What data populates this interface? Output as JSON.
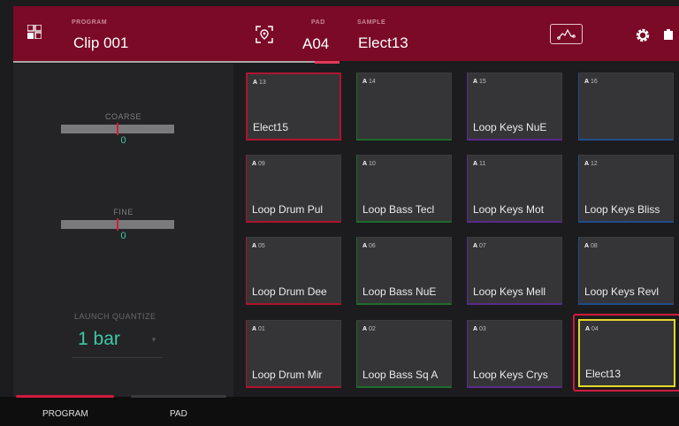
{
  "header": {
    "program_label": "PROGRAM",
    "program_value": "Clip 001",
    "pad_label": "PAD",
    "pad_value": "A04",
    "sample_label": "SAMPLE",
    "sample_value": "Elect13",
    "icons": [
      "grid-icon",
      "locate-icon",
      "envelope-icon",
      "gear-icon",
      "battery-icon"
    ]
  },
  "left_panel": {
    "coarse_label": "COARSE",
    "coarse_value": "0",
    "fine_label": "FINE",
    "fine_value": "0",
    "launch_quantize_label": "LAUNCH QUANTIZE",
    "launch_quantize_value": "1 bar"
  },
  "pads": [
    {
      "bank": "A",
      "num": "13",
      "name": "Elect15",
      "color": "red"
    },
    {
      "bank": "A",
      "num": "14",
      "name": "",
      "color": "green"
    },
    {
      "bank": "A",
      "num": "15",
      "name": "Loop Keys NuE",
      "color": "purple"
    },
    {
      "bank": "A",
      "num": "16",
      "name": "",
      "color": "blue"
    },
    {
      "bank": "A",
      "num": "09",
      "name": "Loop Drum Pul",
      "color": "red"
    },
    {
      "bank": "A",
      "num": "10",
      "name": "Loop Bass Tecl",
      "color": "green"
    },
    {
      "bank": "A",
      "num": "11",
      "name": "Loop Keys Mot",
      "color": "purple"
    },
    {
      "bank": "A",
      "num": "12",
      "name": "Loop Keys Bliss",
      "color": "blue"
    },
    {
      "bank": "A",
      "num": "05",
      "name": "Loop Drum Dee",
      "color": "red"
    },
    {
      "bank": "A",
      "num": "06",
      "name": "Loop Bass NuE",
      "color": "green"
    },
    {
      "bank": "A",
      "num": "07",
      "name": "Loop Keys Mell",
      "color": "purple"
    },
    {
      "bank": "A",
      "num": "08",
      "name": "Loop Keys Revl",
      "color": "blue"
    },
    {
      "bank": "A",
      "num": "01",
      "name": "Loop Drum Mir",
      "color": "red"
    },
    {
      "bank": "A",
      "num": "02",
      "name": "Loop Bass Sq A",
      "color": "green"
    },
    {
      "bank": "A",
      "num": "03",
      "name": "Loop Keys Crys",
      "color": "purple"
    },
    {
      "bank": "A",
      "num": "04",
      "name": "Elect13",
      "color": "selected"
    }
  ],
  "tabs": [
    {
      "label": "PROGRAM",
      "active": true
    },
    {
      "label": "PAD",
      "active": false
    }
  ],
  "colors": {
    "header_bg": "#7a0a26",
    "accent_teal": "#3ec9a7",
    "accent_red": "#d11a3c",
    "selected_yellow": "#e6d72a"
  }
}
